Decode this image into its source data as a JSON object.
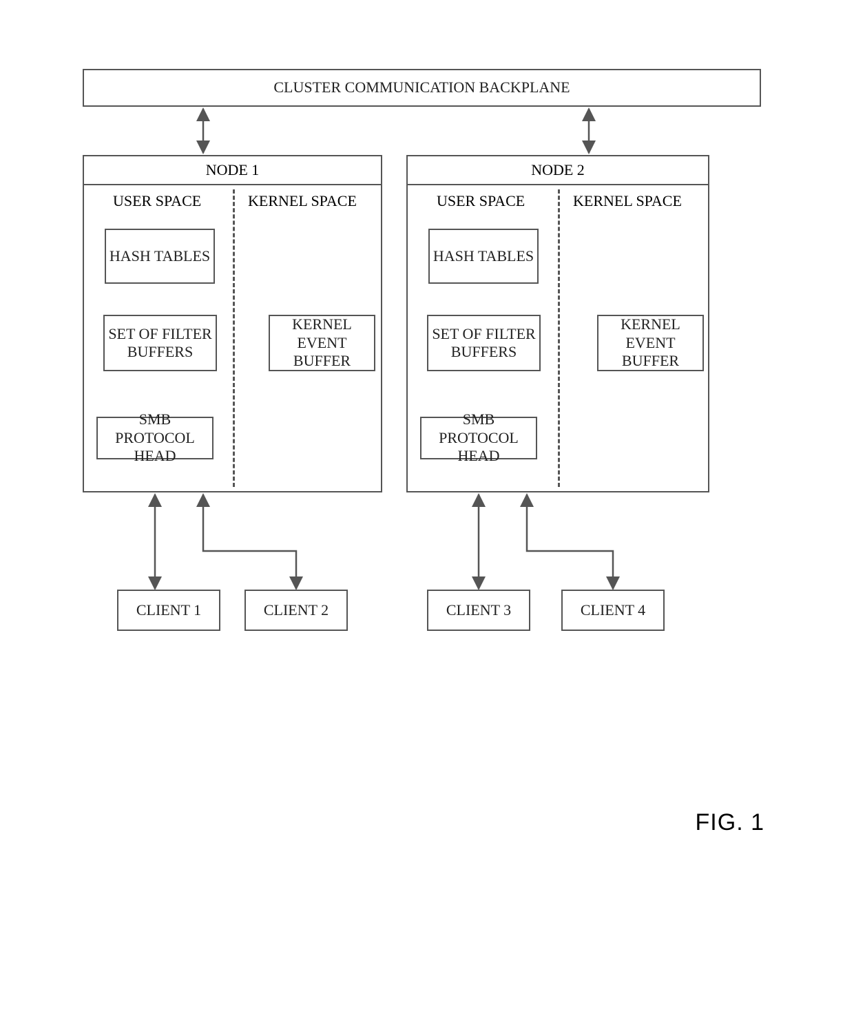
{
  "diagram": {
    "backplane": "CLUSTER COMMUNICATION BACKPLANE",
    "figure_label": "FIG. 1",
    "nodes": [
      {
        "title": "NODE 1",
        "user_space_label": "USER SPACE",
        "kernel_space_label": "KERNEL SPACE",
        "hash_tables": "HASH TABLES",
        "filter_buffers": "SET OF FILTER BUFFERS",
        "kernel_event_buffer": "KERNEL EVENT BUFFER",
        "smb_head": "SMB PROTOCOL HEAD"
      },
      {
        "title": "NODE 2",
        "user_space_label": "USER SPACE",
        "kernel_space_label": "KERNEL SPACE",
        "hash_tables": "HASH TABLES",
        "filter_buffers": "SET OF FILTER BUFFERS",
        "kernel_event_buffer": "KERNEL EVENT BUFFER",
        "smb_head": "SMB PROTOCOL HEAD"
      }
    ],
    "clients": [
      {
        "label": "CLIENT 1"
      },
      {
        "label": "CLIENT 2"
      },
      {
        "label": "CLIENT 3"
      },
      {
        "label": "CLIENT 4"
      }
    ]
  }
}
